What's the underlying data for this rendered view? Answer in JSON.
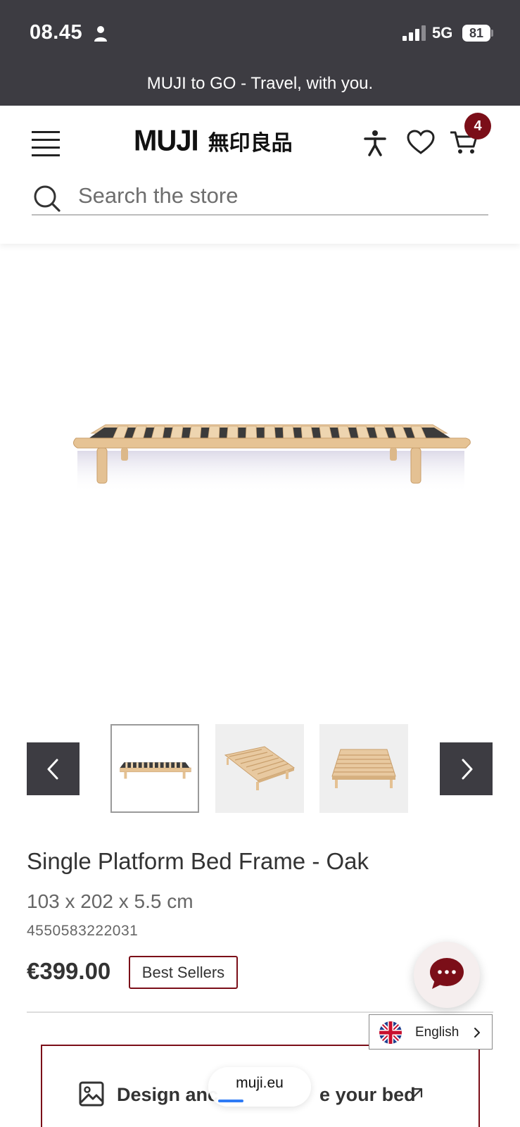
{
  "status_bar": {
    "time": "08.45",
    "network": "5G",
    "battery": "81"
  },
  "promo": {
    "text": "MUJI to GO - Travel, with you."
  },
  "header": {
    "logo_latin": "MUJI",
    "logo_kanji": "無印良品",
    "cart_count": "4"
  },
  "search": {
    "placeholder": "Search the store"
  },
  "gallery": {
    "thumbnails": [
      "thumbnail-side-view",
      "thumbnail-angled-view",
      "thumbnail-front-view"
    ],
    "selected_index": 0
  },
  "product": {
    "title": "Single Platform Bed Frame - Oak",
    "dimensions": "103 x 202 x 5.5 cm",
    "code": "4550583222031",
    "price": "€399.00",
    "badge": "Best Sellers"
  },
  "language": {
    "label": "English"
  },
  "design_card": {
    "text_start": "Design anc",
    "text_end": "e your bed"
  },
  "browser": {
    "url": "muji.eu"
  },
  "colors": {
    "dark": "#3d3c42",
    "accent": "#7b0e18",
    "wood": "#e8c9a0"
  }
}
